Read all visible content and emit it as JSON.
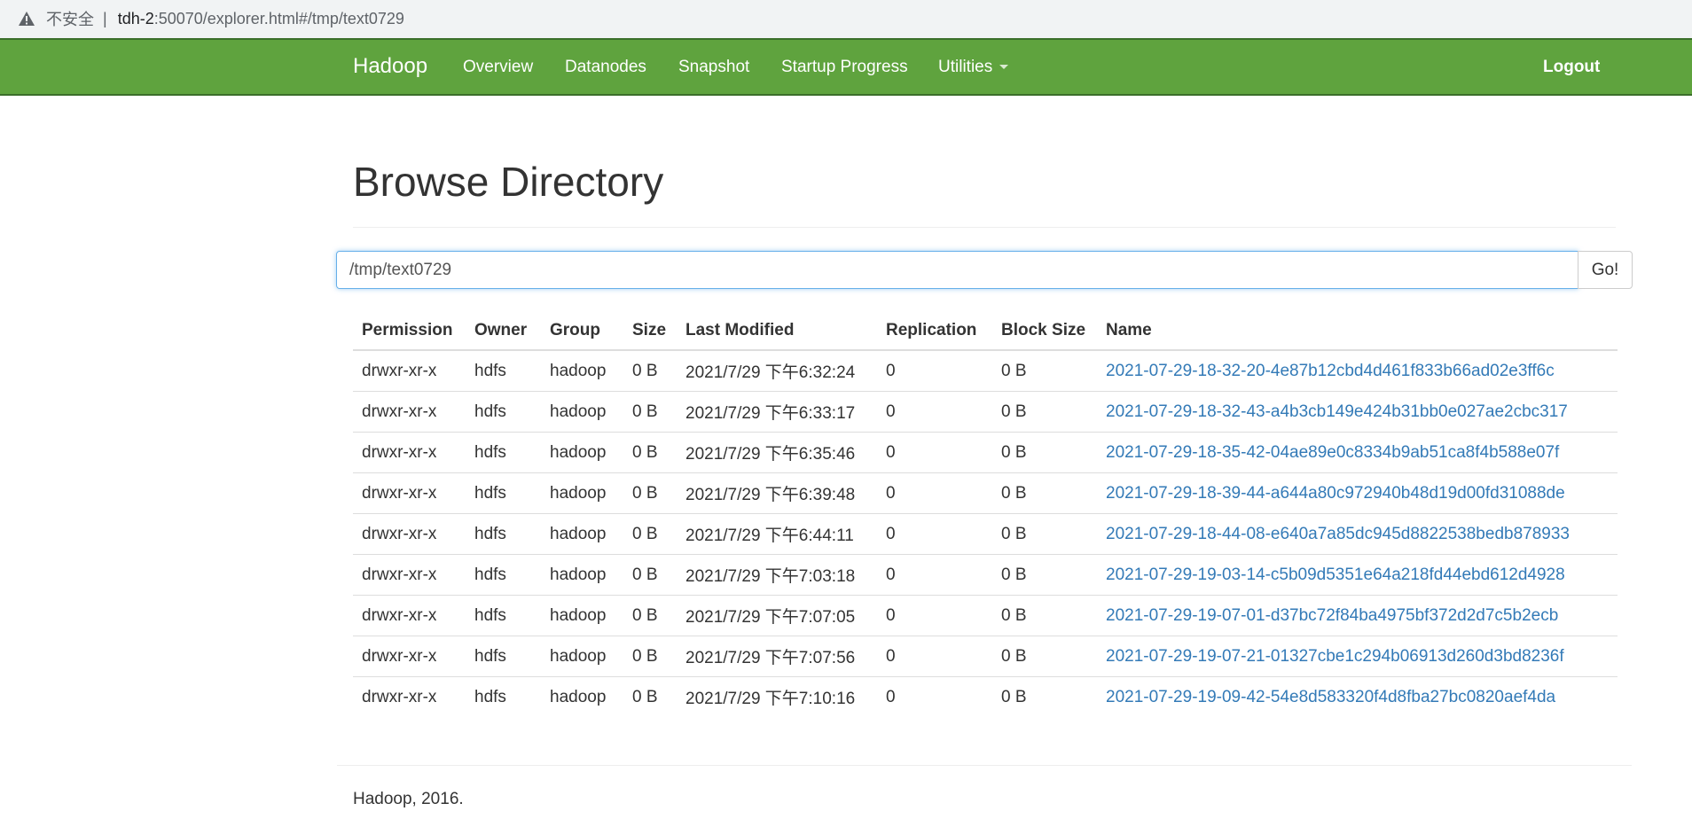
{
  "browser": {
    "security_label": "不安全",
    "separator": "|",
    "url_host": "tdh-2",
    "url_rest": ":50070/explorer.html#/tmp/text0729"
  },
  "navbar": {
    "brand": "Hadoop",
    "items": [
      "Overview",
      "Datanodes",
      "Snapshot",
      "Startup Progress",
      "Utilities"
    ],
    "logout": "Logout",
    "bg_color": "#5fa33e"
  },
  "page": {
    "title": "Browse Directory"
  },
  "path_bar": {
    "value": "/tmp/text0729",
    "go_label": "Go!"
  },
  "table": {
    "headers": [
      "Permission",
      "Owner",
      "Group",
      "Size",
      "Last Modified",
      "Replication",
      "Block Size",
      "Name"
    ],
    "rows": [
      [
        "drwxr-xr-x",
        "hdfs",
        "hadoop",
        "0 B",
        "2021/7/29 下午6:32:24",
        "0",
        "0 B",
        "2021-07-29-18-32-20-4e87b12cbd4d461f833b66ad02e3ff6c"
      ],
      [
        "drwxr-xr-x",
        "hdfs",
        "hadoop",
        "0 B",
        "2021/7/29 下午6:33:17",
        "0",
        "0 B",
        "2021-07-29-18-32-43-a4b3cb149e424b31bb0e027ae2cbc317"
      ],
      [
        "drwxr-xr-x",
        "hdfs",
        "hadoop",
        "0 B",
        "2021/7/29 下午6:35:46",
        "0",
        "0 B",
        "2021-07-29-18-35-42-04ae89e0c8334b9ab51ca8f4b588e07f"
      ],
      [
        "drwxr-xr-x",
        "hdfs",
        "hadoop",
        "0 B",
        "2021/7/29 下午6:39:48",
        "0",
        "0 B",
        "2021-07-29-18-39-44-a644a80c972940b48d19d00fd31088de"
      ],
      [
        "drwxr-xr-x",
        "hdfs",
        "hadoop",
        "0 B",
        "2021/7/29 下午6:44:11",
        "0",
        "0 B",
        "2021-07-29-18-44-08-e640a7a85dc945d8822538bedb878933"
      ],
      [
        "drwxr-xr-x",
        "hdfs",
        "hadoop",
        "0 B",
        "2021/7/29 下午7:03:18",
        "0",
        "0 B",
        "2021-07-29-19-03-14-c5b09d5351e64a218fd44ebd612d4928"
      ],
      [
        "drwxr-xr-x",
        "hdfs",
        "hadoop",
        "0 B",
        "2021/7/29 下午7:07:05",
        "0",
        "0 B",
        "2021-07-29-19-07-01-d37bc72f84ba4975bf372d2d7c5b2ecb"
      ],
      [
        "drwxr-xr-x",
        "hdfs",
        "hadoop",
        "0 B",
        "2021/7/29 下午7:07:56",
        "0",
        "0 B",
        "2021-07-29-19-07-21-01327cbe1c294b06913d260d3bd8236f"
      ],
      [
        "drwxr-xr-x",
        "hdfs",
        "hadoop",
        "0 B",
        "2021/7/29 下午7:10:16",
        "0",
        "0 B",
        "2021-07-29-19-09-42-54e8d583320f4d8fba27bc0820aef4da"
      ]
    ]
  },
  "footer": {
    "text": "Hadoop, 2016."
  }
}
